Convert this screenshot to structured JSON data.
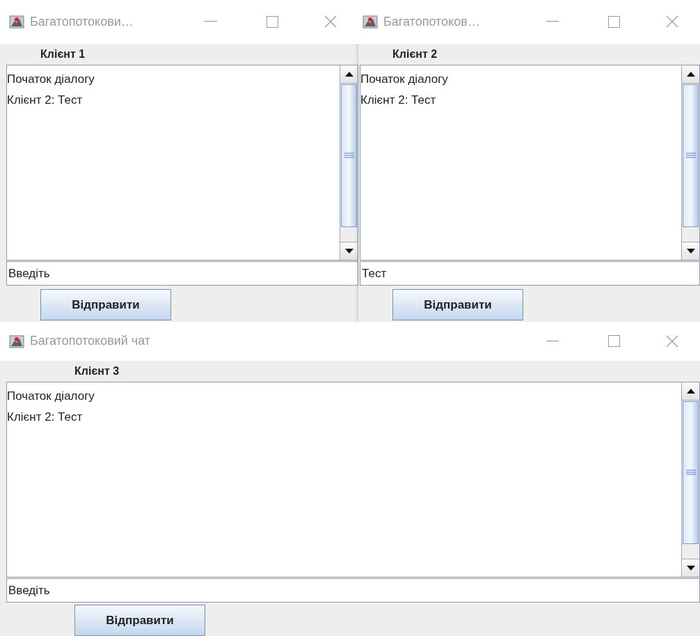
{
  "windows": [
    {
      "title": "Багатопотокови…",
      "label": "Клієнт 1",
      "messages": [
        "Початок діалогу",
        "Клієнт 2: Тест"
      ],
      "input": {
        "value": "Введіть"
      },
      "button": "Відправити"
    },
    {
      "title": "Багатопотоков…",
      "label": "Клієнт 2",
      "messages": [
        "Початок діалогу",
        "Клієнт 2: Тест"
      ],
      "input": {
        "value": "Тест"
      },
      "button": "Відправити"
    },
    {
      "title": "Багатопотоковий чат",
      "label": "Клієнт 3",
      "messages": [
        "Початок діалогу",
        "Клієнт 2: Тест"
      ],
      "input": {
        "value": "Введіть"
      },
      "button": "Відправити"
    }
  ]
}
